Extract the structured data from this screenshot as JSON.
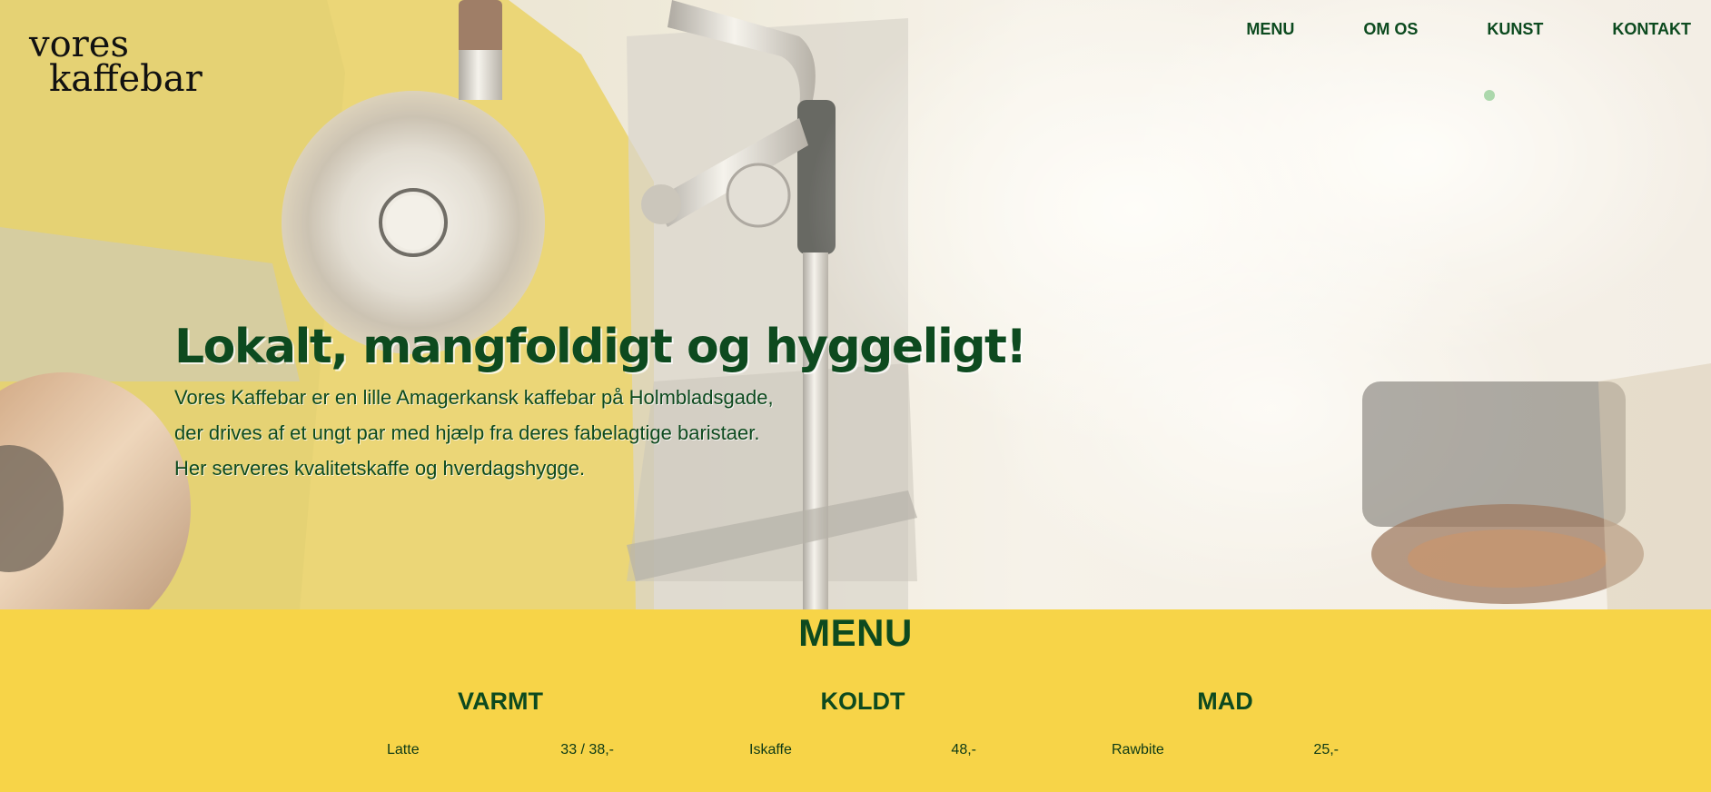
{
  "logo": {
    "line1": "vores",
    "line2": "kaffebar"
  },
  "nav": {
    "items": [
      {
        "label": "MENU"
      },
      {
        "label": "OM OS"
      },
      {
        "label": "KUNST"
      },
      {
        "label": "KONTAKT"
      }
    ]
  },
  "hero": {
    "title": "Lokalt, mangfoldigt og hyggeligt!",
    "lines": [
      "Vores Kaffebar er en lille Amagerkansk kaffebar på Holmbladsgade,",
      "der drives af et ungt par med hjælp fra deres fabelagtige baristaer.",
      "Her serveres kvalitetskaffe og hverdagshygge."
    ]
  },
  "menu": {
    "title": "MENU",
    "columns": [
      {
        "heading": "VARMT",
        "item": "Latte",
        "price": "33 / 38,-"
      },
      {
        "heading": "KOLDT",
        "item": "Iskaffe",
        "price": "48,-"
      },
      {
        "heading": "MAD",
        "item": "Rawbite",
        "price": "25,-"
      }
    ]
  },
  "colors": {
    "brand_green": "#0d4a1f",
    "menu_yellow": "#f7d448",
    "machine_yellow": "#e8c93a"
  }
}
